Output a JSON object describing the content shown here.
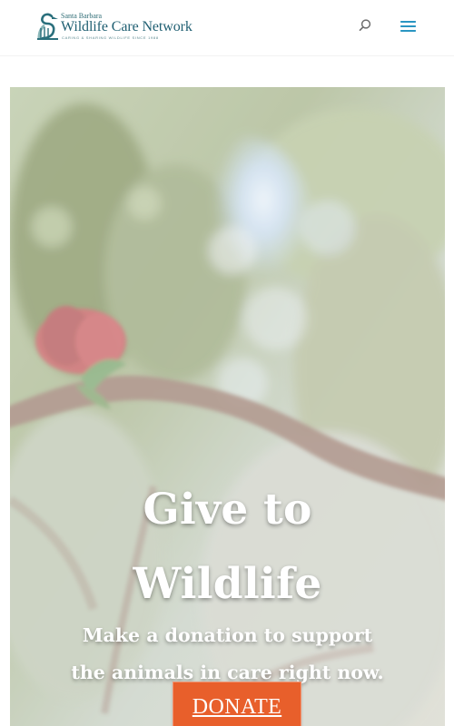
{
  "header": {
    "logo": {
      "small_text": "Santa Barbara",
      "main_text": "Wildlife Care Network",
      "tagline": "caring & sharing wildlife since 1988"
    },
    "search_icon": "search-icon",
    "menu_icon": "menu-icon"
  },
  "hero": {
    "title_lines": [
      "Give to",
      "Wildlife"
    ],
    "subtitle_lines": [
      "Make a donation to support",
      "the animals in care right now."
    ],
    "button_label": "DONATE",
    "colors": {
      "button": "#e85f2b",
      "text": "#ffffff",
      "brand": "#1f5f72",
      "icon": "#2a95c2"
    }
  }
}
